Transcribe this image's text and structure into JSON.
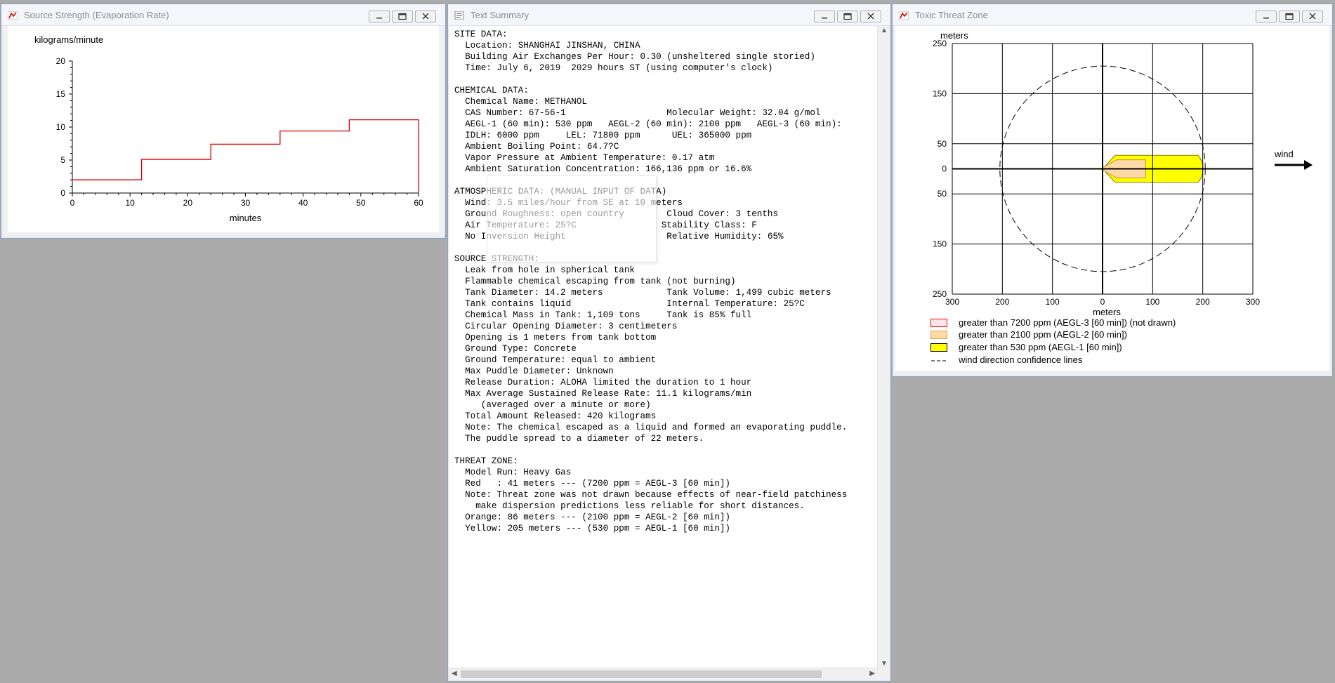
{
  "windows": {
    "source": {
      "title": "Source Strength (Evaporation Rate)"
    },
    "summary": {
      "title": "Text Summary",
      "text": "SITE DATA:\n  Location: SHANGHAI JINSHAN, CHINA\n  Building Air Exchanges Per Hour: 0.30 (unsheltered single storied)\n  Time: July 6, 2019  2029 hours ST (using computer's clock)\n\nCHEMICAL DATA:\n  Chemical Name: METHANOL\n  CAS Number: 67-56-1                   Molecular Weight: 32.04 g/mol\n  AEGL-1 (60 min): 530 ppm   AEGL-2 (60 min): 2100 ppm   AEGL-3 (60 min):\n  IDLH: 6000 ppm     LEL: 71800 ppm      UEL: 365000 ppm\n  Ambient Boiling Point: 64.7?C\n  Vapor Pressure at Ambient Temperature: 0.17 atm\n  Ambient Saturation Concentration: 166,136 ppm or 16.6%\n\nATMOSPHERIC DATA: (MANUAL INPUT OF DATA)\n  Wind: 3.5 miles/hour from SE at 10 meters\n  Ground Roughness: open country        Cloud Cover: 3 tenths\n  Air Temperature: 25?C                Stability Class: F\n  No Inversion Height                   Relative Humidity: 65%\n\nSOURCE STRENGTH:\n  Leak from hole in spherical tank\n  Flammable chemical escaping from tank (not burning)\n  Tank Diameter: 14.2 meters            Tank Volume: 1,499 cubic meters\n  Tank contains liquid                  Internal Temperature: 25?C\n  Chemical Mass in Tank: 1,109 tons     Tank is 85% full\n  Circular Opening Diameter: 3 centimeters\n  Opening is 1 meters from tank bottom\n  Ground Type: Concrete\n  Ground Temperature: equal to ambient\n  Max Puddle Diameter: Unknown\n  Release Duration: ALOHA limited the duration to 1 hour\n  Max Average Sustained Release Rate: 11.1 kilograms/min\n     (averaged over a minute or more)\n  Total Amount Released: 420 kilograms\n  Note: The chemical escaped as a liquid and formed an evaporating puddle.\n  The puddle spread to a diameter of 22 meters.\n\nTHREAT ZONE:\n  Model Run: Heavy Gas\n  Red   : 41 meters --- (7200 ppm = AEGL-3 [60 min])\n  Note: Threat zone was not drawn because effects of near-field patchiness\n    make dispersion predictions less reliable for short distances.\n  Orange: 86 meters --- (2100 ppm = AEGL-2 [60 min])\n  Yellow: 205 meters --- (530 ppm = AEGL-1 [60 min])"
    },
    "threat": {
      "title": "Toxic Threat Zone",
      "wind_label": "wind",
      "legend": [
        {
          "label": "greater than 7200 ppm (AEGL-3 [60 min]) (not drawn)",
          "color": "#ff0000"
        },
        {
          "label": "greater than 2100 ppm (AEGL-2 [60 min])",
          "color": "#ffd9a8"
        },
        {
          "label": "greater than 530 ppm (AEGL-1 [60 min])",
          "color": "#ffff00"
        },
        {
          "label": "wind direction confidence lines",
          "color": "#000000"
        }
      ]
    }
  },
  "chart_data": [
    {
      "type": "line",
      "title": "",
      "ylabel": "kilograms/minute",
      "xlabel": "minutes",
      "xlim": [
        0,
        60
      ],
      "ylim": [
        0,
        20
      ],
      "xticks": [
        0,
        10,
        20,
        30,
        40,
        50,
        60
      ],
      "yticks": [
        0,
        5,
        10,
        15,
        20
      ],
      "step": true,
      "color": "#e00000",
      "x": [
        0,
        12,
        12,
        24,
        24,
        36,
        36,
        48,
        48,
        60,
        60
      ],
      "y": [
        2.0,
        2.0,
        5.1,
        5.1,
        7.4,
        7.4,
        9.4,
        9.4,
        11.1,
        11.1,
        0
      ]
    },
    {
      "type": "area",
      "title": "",
      "xlabel": "meters",
      "ylabel": "meters",
      "xlim": [
        -300,
        300
      ],
      "ylim": [
        -250,
        250
      ],
      "xtick_labels": [
        "300",
        "200",
        "100",
        "0",
        "100",
        "200",
        "300"
      ],
      "ytick_labels": [
        "250",
        "150",
        "50",
        "0",
        "50",
        "150",
        "250"
      ],
      "xticks": [
        -300,
        -200,
        -100,
        0,
        100,
        200,
        300
      ],
      "yticks": [
        250,
        150,
        50,
        0,
        -50,
        -150,
        -250
      ],
      "grid": true,
      "zones": [
        {
          "name": "AEGL-2",
          "color": "#ffd9a8",
          "extent_m": 86,
          "half_width_m": 18
        },
        {
          "name": "AEGL-1",
          "color": "#ffff00",
          "extent_m": 205,
          "half_width_m": 27
        }
      ],
      "confidence_radius_m": 205
    }
  ]
}
